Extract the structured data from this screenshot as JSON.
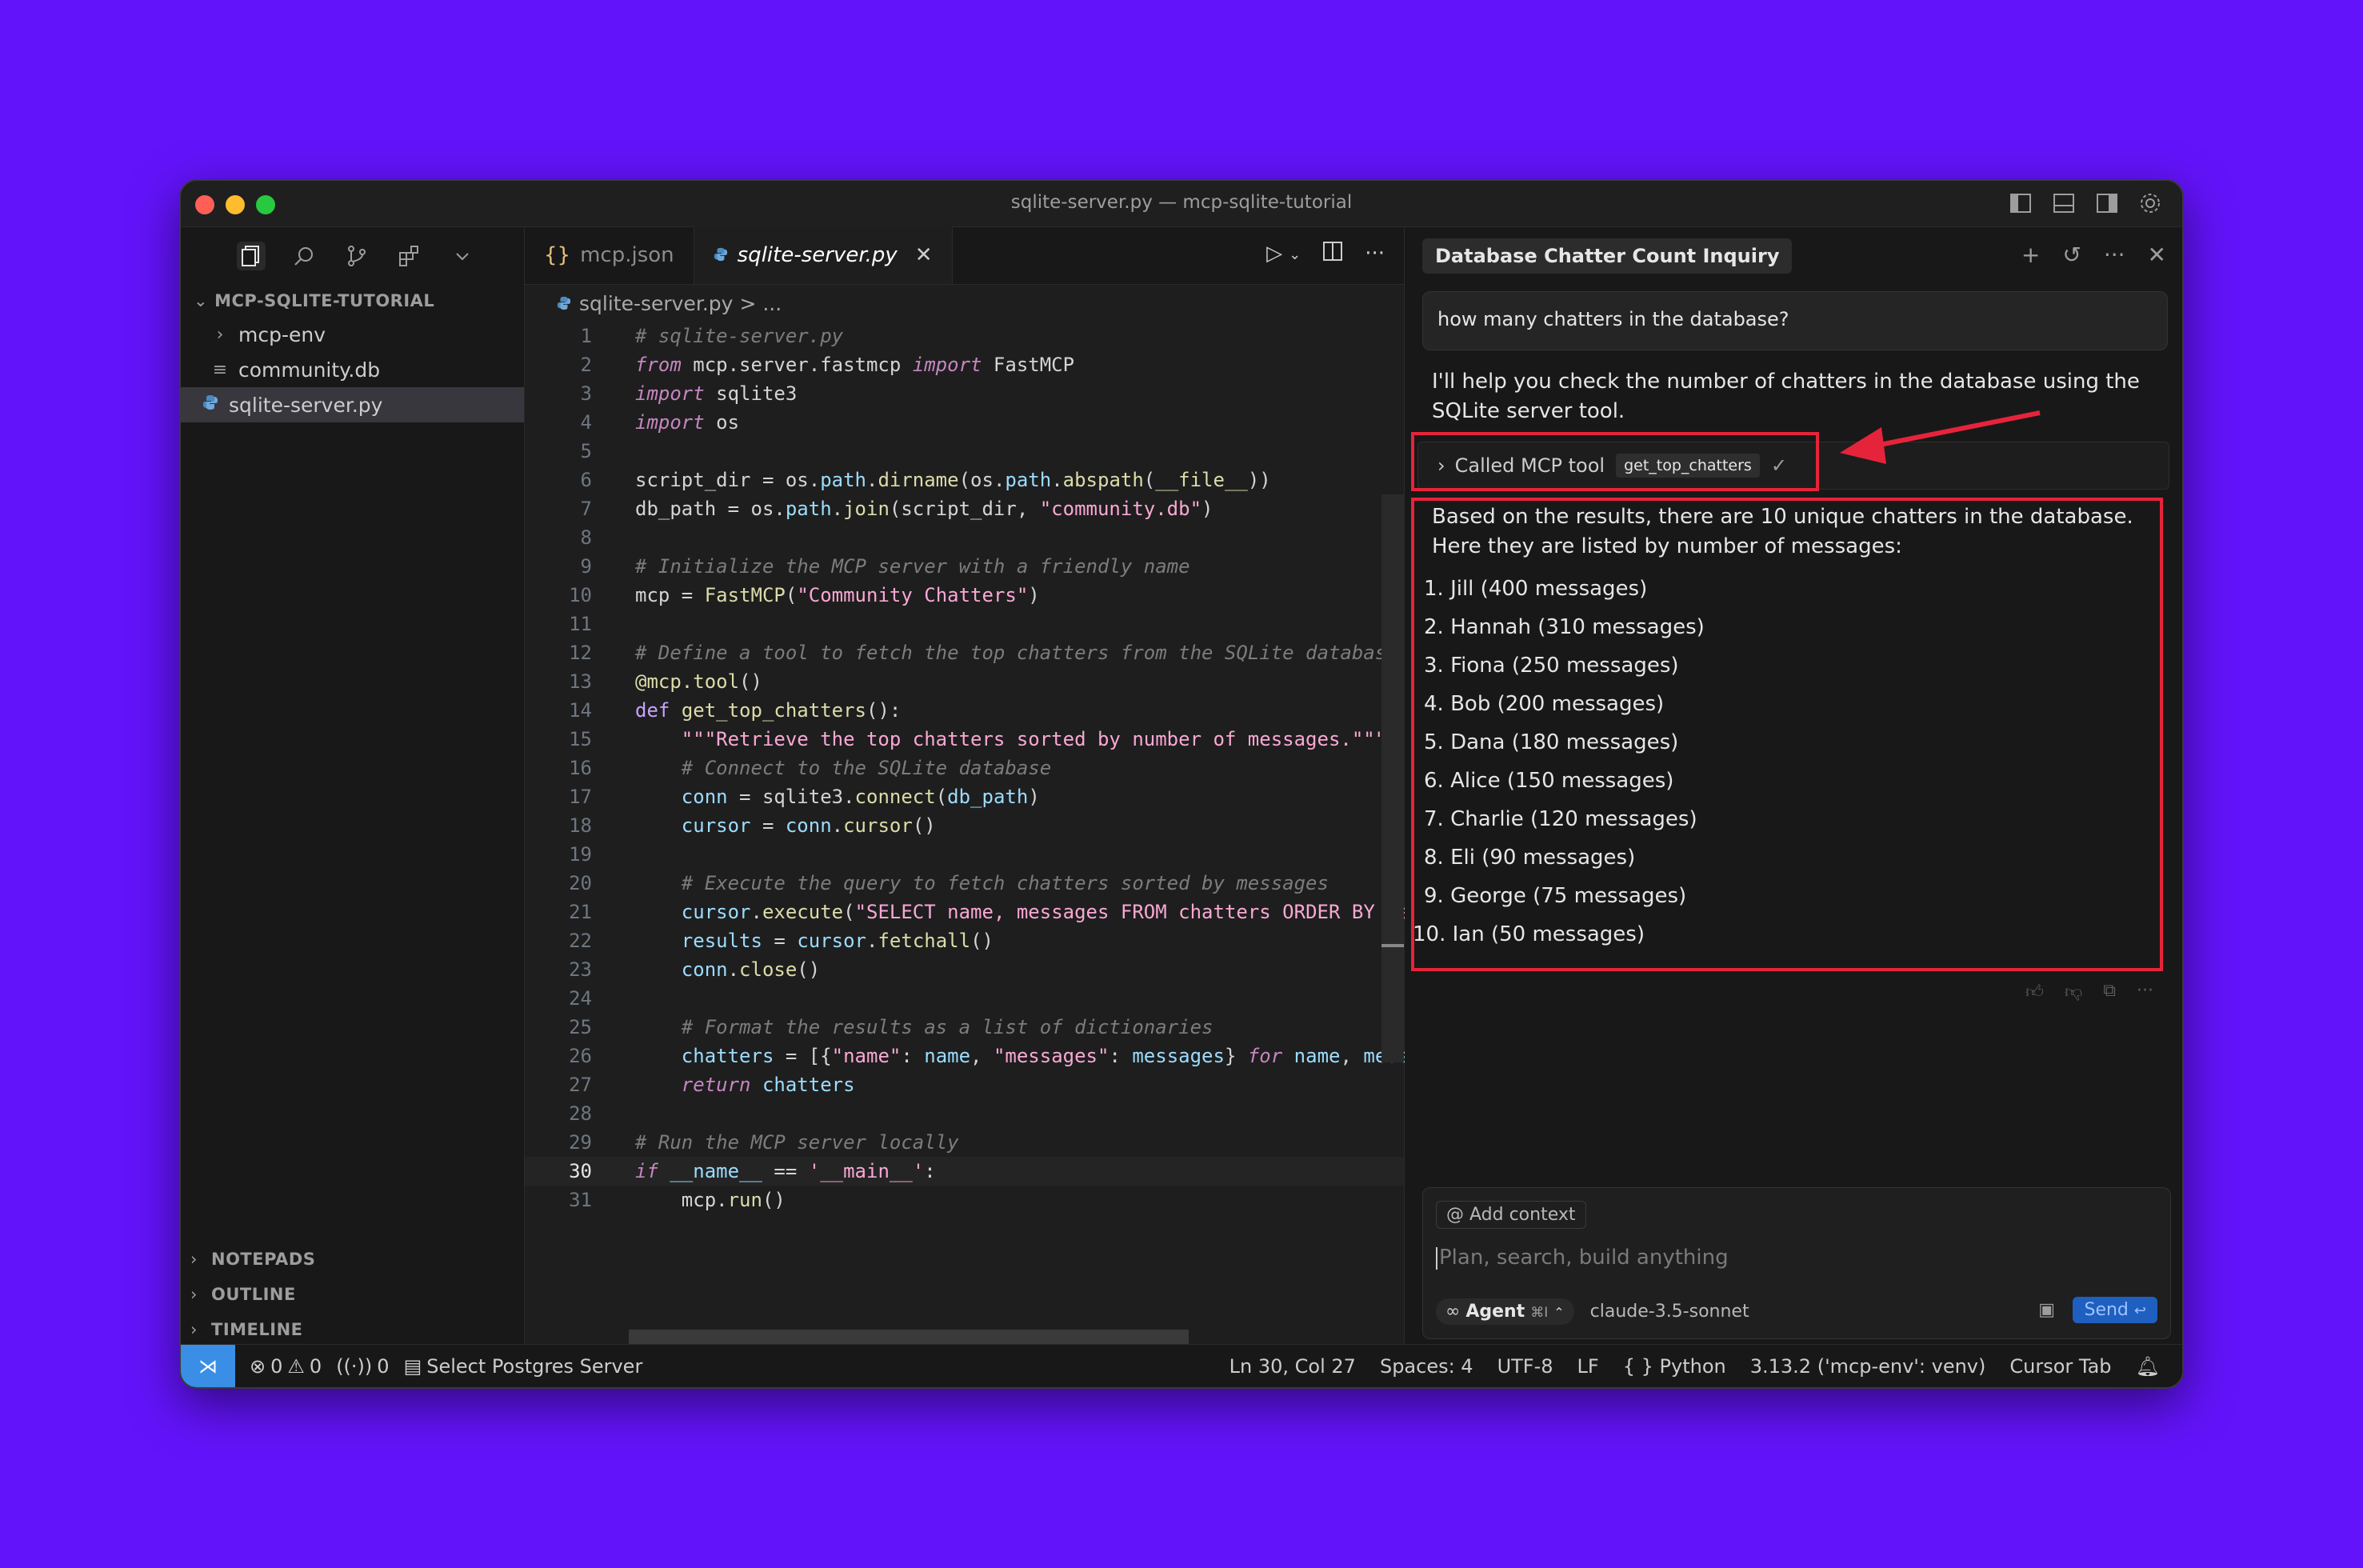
{
  "window": {
    "title": "sqlite-server.py — mcp-sqlite-tutorial"
  },
  "sidebar": {
    "explorer_title": "MCP-SQLITE-TUTORIAL",
    "items": [
      {
        "label": "mcp-env",
        "icon": "chevron-right-icon"
      },
      {
        "label": "community.db",
        "icon": "file-lines-icon"
      },
      {
        "label": "sqlite-server.py",
        "icon": "python-icon",
        "selected": true
      }
    ],
    "sections": [
      "NOTEPADS",
      "OUTLINE",
      "TIMELINE"
    ]
  },
  "editor": {
    "tabs": [
      {
        "label": "mcp.json",
        "icon": "{}",
        "active": false
      },
      {
        "label": "sqlite-server.py",
        "icon": "python",
        "active": true
      }
    ],
    "breadcrumb": {
      "file": "sqlite-server.py",
      "rest": "> ..."
    },
    "line_numbers": [
      "1",
      "2",
      "3",
      "4",
      "5",
      "6",
      "7",
      "8",
      "9",
      "10",
      "11",
      "12",
      "13",
      "14",
      "15",
      "16",
      "17",
      "18",
      "19",
      "20",
      "21",
      "22",
      "23",
      "24",
      "25",
      "26",
      "27",
      "28",
      "29",
      "30",
      "31"
    ],
    "current_line": "30"
  },
  "chat": {
    "title": "Database Chatter Count Inquiry",
    "user_message": "how many chatters in the database?",
    "assistant_intro": "I'll help you check the number of chatters in the database using the SQLite server tool.",
    "tool_call": {
      "label": "Called MCP tool",
      "tool_name": "get_top_chatters",
      "status": "✓"
    },
    "result_intro": "Based on the results, there are 10 unique chatters in the database. Here they are listed by number of messages:",
    "results": [
      "1. Jill (400 messages)",
      "2. Hannah (310 messages)",
      "3. Fiona (250 messages)",
      "4. Bob (200 messages)",
      "5. Dana (180 messages)",
      "6. Alice (150 messages)",
      "7. Charlie (120 messages)",
      "8. Eli (90 messages)",
      "9. George (75 messages)",
      "10. Ian (50 messages)"
    ],
    "composer": {
      "add_context": "Add context",
      "placeholder": "Plan, search, build anything",
      "mode": "Agent",
      "mode_shortcut": "⌘I",
      "model": "claude-3.5-sonnet",
      "send": "Send"
    }
  },
  "status": {
    "errors": "0",
    "warnings": "0",
    "ports": "0",
    "postgres": "Select Postgres Server",
    "position": "Ln 30, Col 27",
    "spaces": "Spaces: 4",
    "encoding": "UTF-8",
    "eol": "LF",
    "language": "Python",
    "interpreter": "3.13.2 ('mcp-env': venv)",
    "cursor_tab": "Cursor Tab"
  },
  "colors": {
    "background": "#6313fa",
    "highlight": "#e5243b",
    "accent": "#3a8ee6"
  }
}
